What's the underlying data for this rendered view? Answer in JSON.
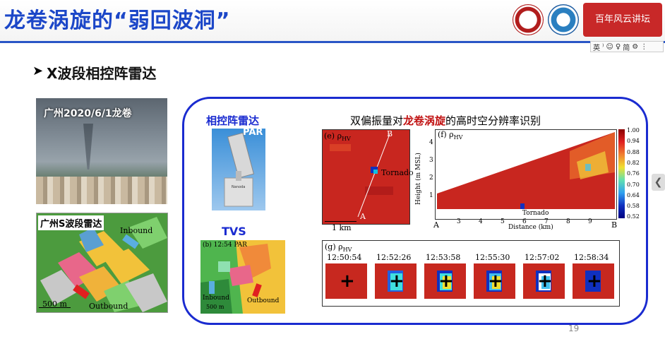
{
  "slide": {
    "title": "龙卷涡旋的“弱回波洞”",
    "subtitle_bullet": "➤",
    "subtitle": "X波段相控阵雷达",
    "page_number": "19"
  },
  "logos": {
    "forum_logo_text": "百年风云讲坛"
  },
  "ime_toolbar": {
    "items": [
      "英",
      "⁾",
      "☺",
      "♀",
      "简",
      "⚙",
      "⋮"
    ]
  },
  "photo_panel": {
    "label": "广州2020/6/1龙卷"
  },
  "sband_panel": {
    "label": "广州S波段雷达",
    "inbound": "Inbound",
    "outbound": "Outbound",
    "scale": "500 m"
  },
  "par_panel": {
    "label": "相控阵雷达",
    "tag": "PAR",
    "maker": "Nanoda"
  },
  "tvs_panel": {
    "label": "TVS",
    "caption": "(b) 12:54 PAR",
    "inbound": "Inbound",
    "outbound": "Outbound",
    "scale": "500 m"
  },
  "dual_pol": {
    "title_pre": "双偏振量对",
    "title_bold": "龙卷涡旋",
    "title_post": "的高时空分辨率识别"
  },
  "panel_e": {
    "caption": "(e) ρ",
    "caption_sub": "HV",
    "point_a": "A",
    "point_b": "B",
    "tornado": "Tornado",
    "scale": "1 km"
  },
  "panel_f": {
    "caption": "(f) ρ",
    "caption_sub": "HV",
    "ylabel": "Height (m MSL)",
    "xlabel": "Distance (km)",
    "tornado": "Tornado",
    "point_a": "A",
    "point_b": "B",
    "y_ticks": [
      "1",
      "2",
      "3",
      "4"
    ],
    "x_ticks": [
      "3",
      "4",
      "5",
      "6",
      "7",
      "8",
      "9"
    ],
    "colorbar_ticks": [
      "1.00",
      "0.94",
      "0.88",
      "0.82",
      "0.76",
      "0.70",
      "0.64",
      "0.58",
      "0.52"
    ]
  },
  "panel_g": {
    "caption": "(g) ρ",
    "caption_sub": "HV",
    "times": [
      "12:50:54",
      "12:52:26",
      "12:53:58",
      "12:55:30",
      "12:57:02",
      "12:58:34"
    ]
  },
  "colors": {
    "title_blue": "#1c47c8",
    "panel_border": "#1a2bd0",
    "accent_red": "#c01010"
  }
}
